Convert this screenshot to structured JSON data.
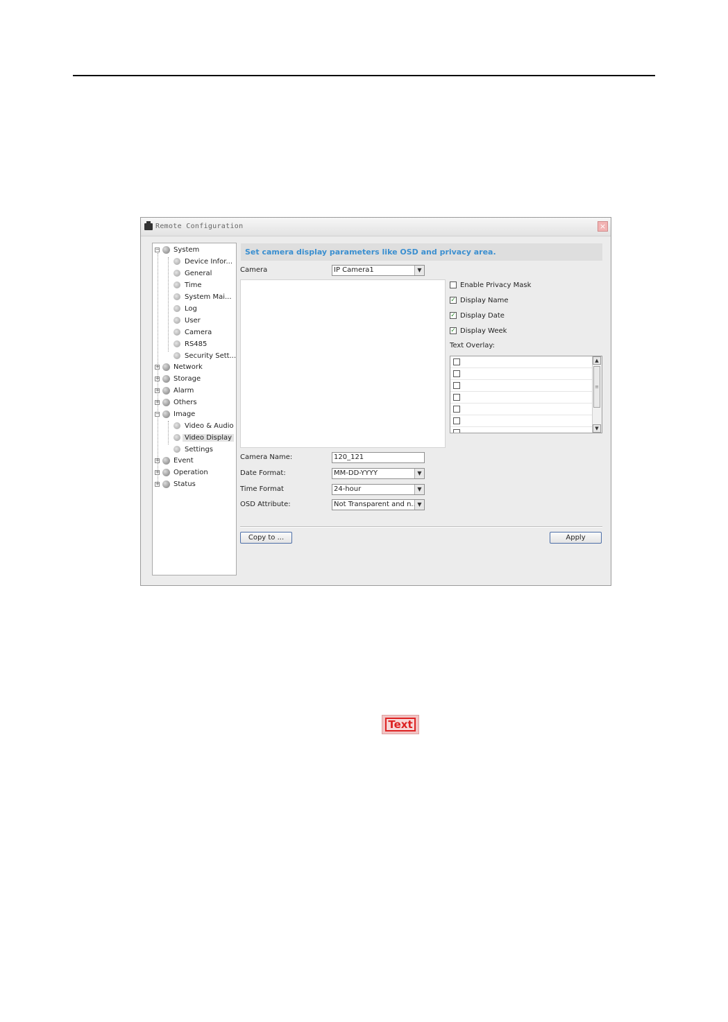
{
  "window": {
    "title": "Remote Configuration",
    "close_glyph": "×"
  },
  "tree": {
    "system": "System",
    "system_children": [
      "Device Infor...",
      "General",
      "Time",
      "System Mai...",
      "Log",
      "User",
      "Camera",
      "RS485",
      "Security Sett..."
    ],
    "network": "Network",
    "storage": "Storage",
    "alarm": "Alarm",
    "others": "Others",
    "image": "Image",
    "image_children": [
      "Video & Audio",
      "Video Display",
      "Settings"
    ],
    "event": "Event",
    "operation": "Operation",
    "status": "Status",
    "selected": "Video Display"
  },
  "banner": "Set camera display parameters like OSD and privacy area.",
  "form": {
    "camera_label": "Camera",
    "camera_value": "IP Camera1",
    "camera_name_label": "Camera Name:",
    "camera_name_value": "120_121",
    "date_format_label": "Date Format:",
    "date_format_value": "MM-DD-YYYY",
    "time_format_label": "Time Format",
    "time_format_value": "24-hour",
    "osd_label": "OSD Attribute:",
    "osd_value": "Not Transparent and n..."
  },
  "checks": {
    "privacy_mask": "Enable Privacy Mask",
    "display_name": "Display Name",
    "display_date": "Display Date",
    "display_week": "Display Week",
    "text_overlay": "Text Overlay:"
  },
  "check_glyph": "✓",
  "buttons": {
    "copy": "Copy to ...",
    "apply": "Apply"
  },
  "glyphs": {
    "expand": "+",
    "collapse": "−",
    "dropdown": "▼",
    "scroll_up": "▲",
    "scroll_down": "▼",
    "grip": "≡"
  },
  "text_icon_label": "Text"
}
